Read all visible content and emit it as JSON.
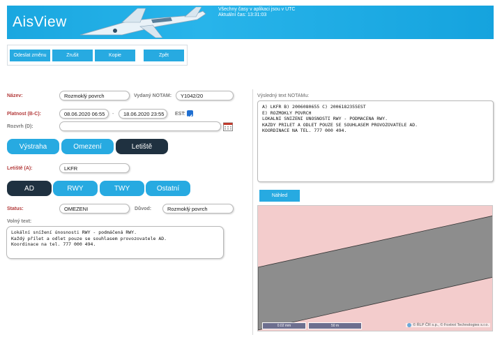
{
  "header": {
    "logo_text": "AisView",
    "info_line1": "Všechny časy v aplikaci jsou v UTC",
    "info_line2": "Aktuální čas: 13:31:03"
  },
  "toolbar": {
    "submit_label": "Odeslat změnu",
    "cancel_label": "Zrušit",
    "copy_label": "Kopie",
    "back_label": "Zpět"
  },
  "form": {
    "name_label": "Název:",
    "name_value": "Rozmoklý povrch",
    "notam_label": "Vydaný NOTAM:",
    "notam_value": "Y1042/20",
    "validity_label": "Platnost (B-C):",
    "valid_from": "08.06.2020 06:55",
    "dash": "-",
    "valid_to": "18.06.2020 23:55",
    "est_label": "EST:",
    "schedule_label": "Rozvrh (D):",
    "schedule_value": "",
    "category_tabs": [
      "Výstraha",
      "Omezení",
      "Letiště"
    ],
    "aerodrome_label": "Letiště (A):",
    "aerodrome_value": "LKFR",
    "sub_tabs": [
      "AD",
      "RWY",
      "TWY",
      "Ostatní"
    ],
    "status_label": "Status:",
    "status_value": "OMEZENI",
    "reason_label": "Důvod:",
    "reason_value": "Rozmoklý povrch",
    "free_text_label": "Volný text:",
    "free_text_lines": [
      "Lokální snížení únosnosti RWY - podmáčená RWY.",
      "Každý přílet a odlet pouze se souhlasem provozovatele AD.",
      "Koordinace na tel. 777 000 494."
    ]
  },
  "result": {
    "label": "Výsledný text NOTAMu:",
    "lines": [
      "A) LKFR B) 2006080655 C) 2006182355EST",
      "E) ROZMOKLY POVRCH",
      "LOKALNI SNIZENI UNOSNOSTI RWY - PODMACENA RWY.",
      "KAZDY PRILET A ODLET POUZE SE SOUHLASEM PROVOZOVATELE AD.",
      "KOORDINACE NA TEL. 777 000 494."
    ],
    "preview_label": "Náhled"
  },
  "map": {
    "scale1": "0.02 mm",
    "scale2": "50 m",
    "attribution": "© ŘLP ČR s.p., © Foxtrot Technologies s.r.o."
  }
}
